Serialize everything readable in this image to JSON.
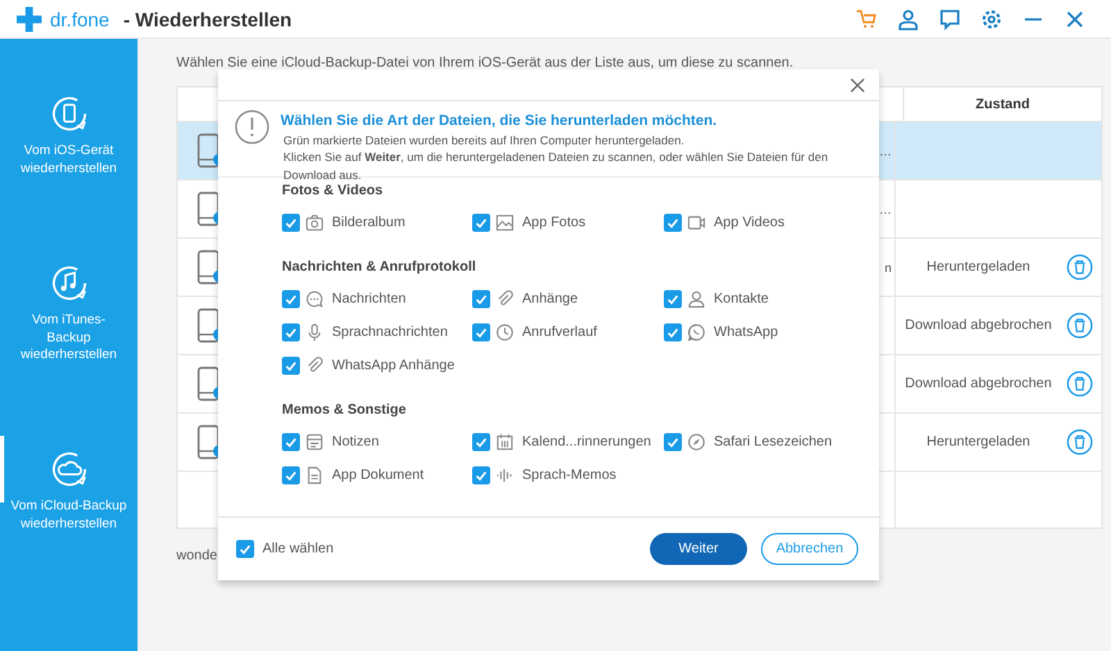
{
  "app": {
    "logo": "dr.fone",
    "title": "- Wiederherstellen"
  },
  "sidebar": {
    "items": [
      {
        "label": "Vom iOS-Gerät wiederherstellen",
        "selected": false
      },
      {
        "label": "Vom iTunes-Backup wiederherstellen",
        "selected": false
      },
      {
        "label": "Vom iCloud-Backup wiederherstellen",
        "selected": true
      }
    ]
  },
  "instruction": "Wählen Sie eine iCloud-Backup-Datei von Ihrem iOS-Gerät aus der Liste aus, um diese zu scannen.",
  "table": {
    "columns": [
      "Zustand"
    ],
    "rows": [
      {
        "selected": true,
        "column_2": "…"
      },
      {
        "selected": false,
        "column_2": "…"
      },
      {
        "selected": false,
        "column_2": "n",
        "status": "Heruntergeladen"
      },
      {
        "selected": false,
        "status": "Download abgebrochen"
      },
      {
        "selected": false,
        "status": "Download abgebrochen"
      },
      {
        "selected": false,
        "status": "Heruntergeladen"
      }
    ]
  },
  "below_table_text": "wonde",
  "dialog": {
    "heading": "Wählen Sie die Art der Dateien, die Sie herunterladen möchten.",
    "notes": [
      "Grün markierte Dateien wurden bereits auf Ihren Computer heruntergeladen.",
      "Klicken Sie auf **Weiter**, um die heruntergeladenen Dateien zu scannen, oder wählen Sie Dateien für den Download aus."
    ],
    "sections": [
      {
        "title": "Fotos & Videos",
        "items": [
          {
            "label": "Bilderalbum",
            "checked": true
          },
          {
            "label": "App Fotos",
            "checked": true
          },
          {
            "label": "App Videos",
            "checked": true
          }
        ]
      },
      {
        "title": "Nachrichten & Anrufprotokoll",
        "items": [
          {
            "label": "Nachrichten",
            "checked": true
          },
          {
            "label": "Anhänge",
            "checked": true
          },
          {
            "label": "Kontakte",
            "checked": true
          },
          {
            "label": "Sprachnachrichten",
            "checked": true
          },
          {
            "label": "Anrufverlauf",
            "checked": true
          },
          {
            "label": "WhatsApp",
            "checked": true
          },
          {
            "label": "WhatsApp Anhänge",
            "checked": true
          }
        ]
      },
      {
        "title": "Memos & Sonstige",
        "items": [
          {
            "label": "Notizen",
            "checked": true
          },
          {
            "label": "Kalend...rinnerungen",
            "checked": true
          },
          {
            "label": "Safari Lesezeichen",
            "checked": true
          },
          {
            "label": "App Dokument",
            "checked": true
          },
          {
            "label": "Sprach-Memos",
            "checked": true
          }
        ]
      }
    ],
    "select_all": {
      "label": "Alle wählen",
      "checked": true
    },
    "buttons": [
      {
        "label": "Weiter",
        "kind": "primary"
      },
      {
        "label": "Abbrechen",
        "kind": "secondary"
      }
    ]
  }
}
